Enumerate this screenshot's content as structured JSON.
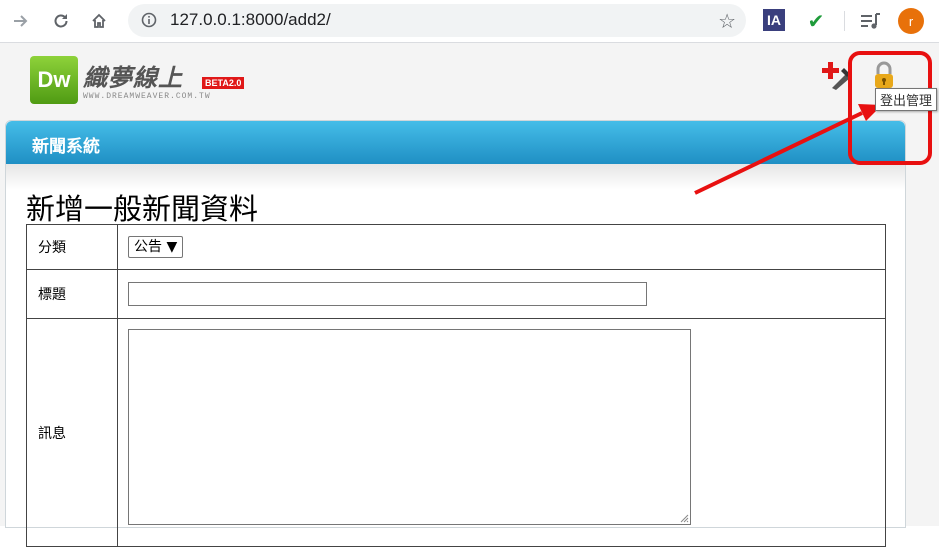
{
  "browser": {
    "url": "127.0.0.1:8000/add2/",
    "avatar_letter": "r",
    "extension_ia_label": "IA"
  },
  "site": {
    "logo_badge": "Dw",
    "logo_name": "織夢線上",
    "logo_beta": "BETA2.0",
    "logo_url": "WWW.DREAMWEAVER.COM.TW",
    "tooltip": "登出管理"
  },
  "panel": {
    "title": "新聞系統"
  },
  "form": {
    "title": "新增一般新聞資料",
    "rows": [
      {
        "label": "分類",
        "value": "公告 ▼"
      },
      {
        "label": "標題",
        "value": ""
      },
      {
        "label": "訊息",
        "value": ""
      }
    ]
  },
  "colors": {
    "header_gradient_top": "#45bde8",
    "header_gradient_bottom": "#1f8fc4",
    "annotation_red": "#e81010"
  }
}
